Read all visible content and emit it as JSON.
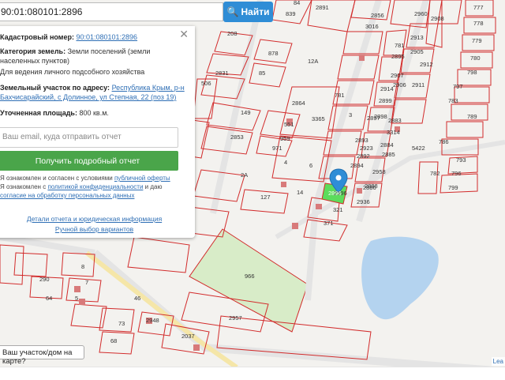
{
  "search": {
    "value": "90:01:080101:2896",
    "button_label": "Найти"
  },
  "panel": {
    "cadastral_label": "Кадастровый номер:",
    "cadastral_value": "90:01:080101:2896",
    "category_label": "Категория земель:",
    "category_value": "Земли поселений (земли населенных пунктов)",
    "use_value": "Для ведения личного подсобного хозяйства",
    "address_label": "Земельный участок по адресу:",
    "address_value": "Республика Крым, р-н Бахчисарайский, с Долинное, ул Степная, 22 (поз 19)",
    "area_label": "Уточненная площадь:",
    "area_value": "800 кв.м.",
    "email_placeholder": "Ваш email, куда отправить отчет",
    "order_button": "Получить подробный отчет",
    "consent_1": "Я ознакомлен и согласен с условиями",
    "consent_1_link": "публичной оферты",
    "consent_2": "Я ознакомлен с",
    "consent_2_link": "политикой конфиденциальности",
    "consent_2_end": "и даю",
    "consent_3_link": "согласие на обработку персональных данных",
    "details_link": "Детали отчета и юридическая информация",
    "manual_link": "Ручной выбор вариантов"
  },
  "question_button": "Ваш участок/дом на карте?",
  "attribution": "Lea",
  "map_labels": [
    "84",
    "839",
    "2891",
    "2856",
    "3016",
    "2960",
    "2908",
    "777",
    "778",
    "779",
    "780",
    "781",
    "2895",
    "2905",
    "2907",
    "2906",
    "2911",
    "2912",
    "2913",
    "2914",
    "2899",
    "2897",
    "2898",
    "2893",
    "2888",
    "2883",
    "3314",
    "5422",
    "2884",
    "2885",
    "2923",
    "2892",
    "2894",
    "2958",
    "2886",
    "2936",
    "321",
    "371",
    "2896",
    "781",
    "3365",
    "2864",
    "551",
    "959",
    "971",
    "149",
    "2853",
    "878",
    "85",
    "208",
    "506",
    "2831",
    "127",
    "966",
    "2957",
    "2948",
    "2037",
    "290",
    "73",
    "68",
    "8",
    "7",
    "64",
    "46",
    "5",
    "793",
    "796",
    "799",
    "786",
    "782",
    "789",
    "783",
    "797",
    "798",
    "12А",
    "14",
    "6",
    "3",
    "4",
    "2А"
  ],
  "highlight": {
    "color": "#5cdc5c",
    "label": "2896"
  },
  "colors": {
    "parcel": "#d22b2b",
    "road": "#eaeaea",
    "water": "#b4d3ef",
    "park": "#d8ecc8",
    "marker": "#2f8dd6"
  }
}
